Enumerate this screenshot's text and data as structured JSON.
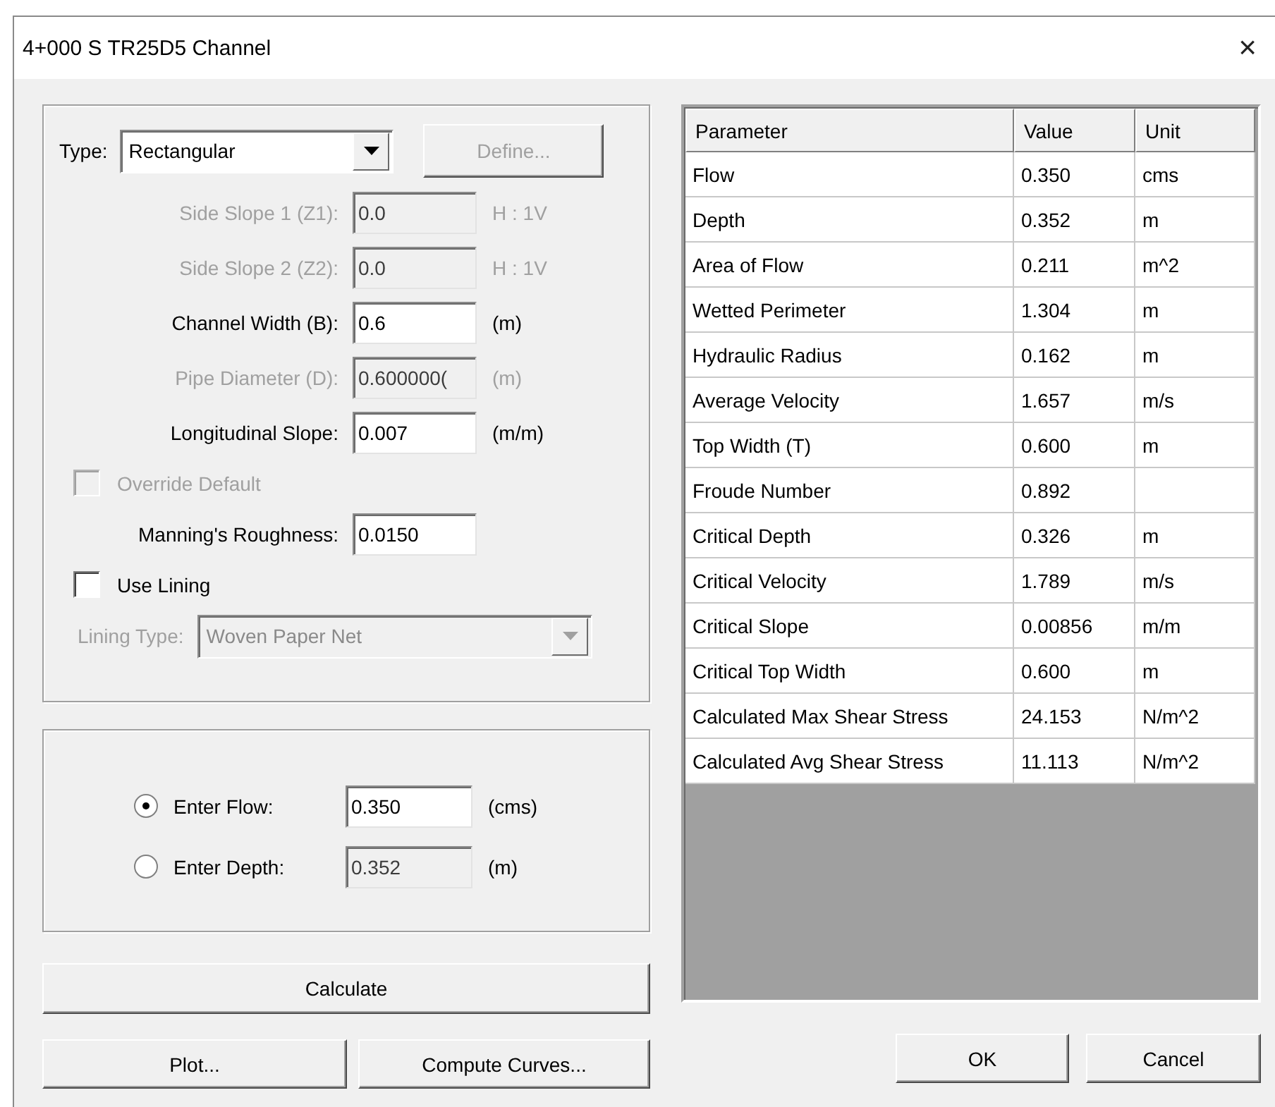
{
  "window": {
    "title": "4+000 S TR25D5 Channel",
    "close": "×"
  },
  "channel_section": {
    "type_label": "Type:",
    "type_value": "Rectangular",
    "define_button": {
      "label": "Define...",
      "disabled": true
    },
    "rows": [
      {
        "kind": "field",
        "label": "Side Slope 1 (Z1):",
        "value": "0.0",
        "unit": "H : 1V",
        "disabled": true
      },
      {
        "kind": "field",
        "label": "Side Slope 2 (Z2):",
        "value": "0.0",
        "unit": "H : 1V",
        "disabled": true
      },
      {
        "kind": "field",
        "label": "Channel Width (B):",
        "value": "0.6",
        "unit": "(m)",
        "disabled": false
      },
      {
        "kind": "field",
        "label": "Pipe Diameter (D):",
        "value": "0.600000(",
        "unit": "(m)",
        "disabled": true
      },
      {
        "kind": "field",
        "label": "Longitudinal Slope:",
        "value": "0.007",
        "unit": "(m/m)",
        "disabled": false
      },
      {
        "kind": "checkbox",
        "label": "Override Default",
        "checked": false,
        "disabled": true
      },
      {
        "kind": "field",
        "label": "Manning's Roughness:",
        "value": "0.0150",
        "disabled": false
      },
      {
        "kind": "checkbox",
        "label": "Use Lining",
        "checked": false,
        "disabled": false
      },
      {
        "kind": "dropdown",
        "label": "Lining Type:",
        "value": "Woven Paper Net",
        "disabled": true
      }
    ]
  },
  "flow_section": {
    "options": [
      {
        "label": "Enter Flow:",
        "selected": true,
        "value": "0.350",
        "unit": "(cms)"
      },
      {
        "label": "Enter Depth:",
        "selected": false,
        "value": "0.352",
        "unit": "(m)"
      }
    ]
  },
  "buttons": {
    "calculate": "Calculate",
    "plot": "Plot...",
    "compute_curves": "Compute Curves...",
    "ok": "OK",
    "cancel": "Cancel"
  },
  "table": {
    "columns": [
      "Parameter",
      "Value",
      "Unit"
    ],
    "rows": [
      [
        "Flow",
        "0.350",
        "cms"
      ],
      [
        "Depth",
        "0.352",
        "m"
      ],
      [
        "Area of Flow",
        "0.211",
        "m^2"
      ],
      [
        "Wetted Perimeter",
        "1.304",
        "m"
      ],
      [
        "Hydraulic Radius",
        "0.162",
        "m"
      ],
      [
        "Average Velocity",
        "1.657",
        "m/s"
      ],
      [
        "Top Width (T)",
        "0.600",
        "m"
      ],
      [
        "Froude Number",
        "0.892",
        ""
      ],
      [
        "Critical Depth",
        "0.326",
        "m"
      ],
      [
        "Critical Velocity",
        "1.789",
        "m/s"
      ],
      [
        "Critical Slope",
        "0.00856",
        "m/m"
      ],
      [
        "Critical Top Width",
        "0.600",
        "m"
      ],
      [
        "Calculated Max Shear Stress",
        "24.153",
        "N/m^2"
      ],
      [
        "Calculated Avg Shear Stress",
        "11.113",
        "N/m^2"
      ]
    ]
  }
}
